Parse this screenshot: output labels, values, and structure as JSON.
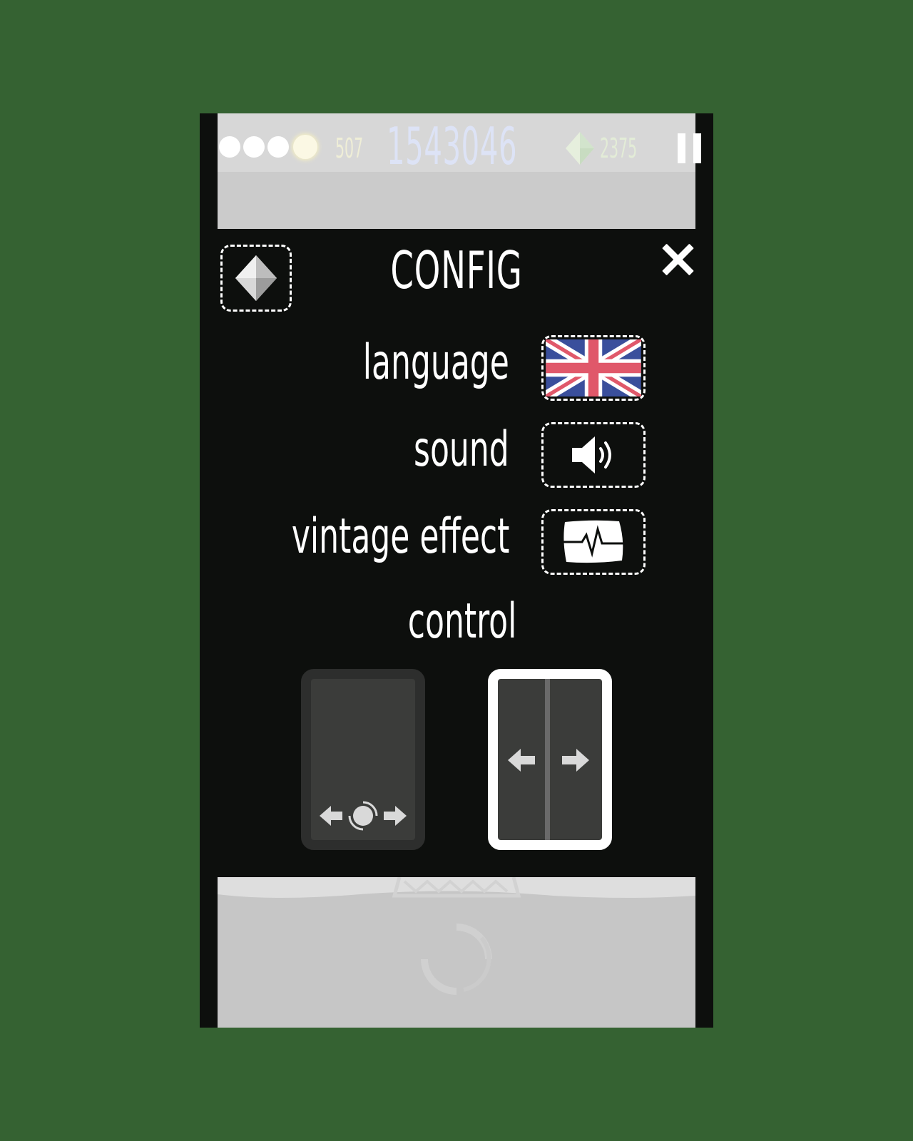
{
  "hud": {
    "lives": 4,
    "coins": "507",
    "score": "1543046",
    "gems": "2375"
  },
  "config": {
    "title": "CONFIG",
    "rows": [
      {
        "label": "language",
        "value": "english-flag-icon"
      },
      {
        "label": "sound",
        "value": "speaker-on-icon"
      },
      {
        "label": "vintage effect",
        "value": "crt-effect-icon"
      }
    ],
    "control_label": "control",
    "control_options": [
      {
        "name": "joystick",
        "selected": false
      },
      {
        "name": "split-screen",
        "selected": true
      }
    ]
  },
  "colors": {
    "background": "#356232",
    "panel": "#0d0f0d",
    "flag_blue": "#3a4f9c",
    "flag_red": "#e0586a"
  }
}
